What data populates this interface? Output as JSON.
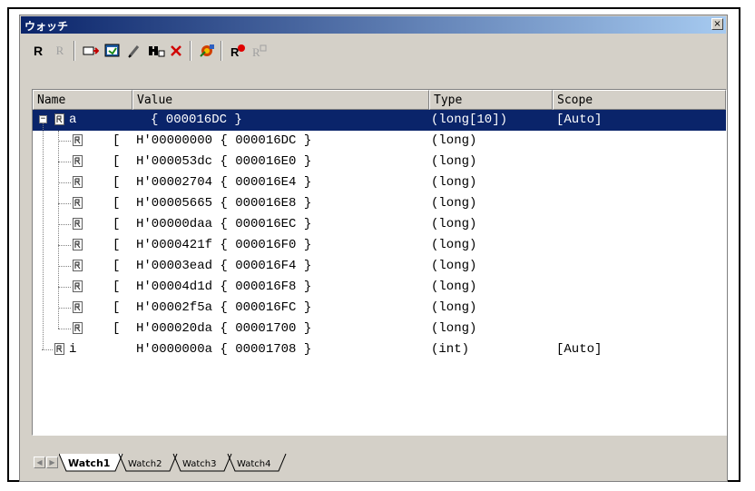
{
  "window": {
    "title": "ウォッチ",
    "close_glyph": "×"
  },
  "toolbar": {
    "icons": [
      "r-bold-icon",
      "r-disabled-icon",
      "add-watch-icon",
      "refresh-icon",
      "edit-pencil-icon",
      "find-icon",
      "delete-x-icon",
      "settings-icon",
      "record-icon",
      "record-disabled-icon"
    ],
    "r_label": "R",
    "r_disabled_label": "R"
  },
  "columns": [
    "Name",
    "Value",
    "Type",
    "Scope"
  ],
  "rows": [
    {
      "name": "a",
      "bracket": "",
      "value": "{ 000016DC }",
      "type": "(long[10])",
      "scope": "[Auto]",
      "selected": true,
      "level": 0,
      "expander": "−"
    },
    {
      "name": "",
      "bracket": "[",
      "value": "H'00000000 { 000016DC }",
      "type": "(long)",
      "scope": "",
      "level": 1
    },
    {
      "name": "",
      "bracket": "[",
      "value": "H'000053dc { 000016E0 }",
      "type": "(long)",
      "scope": "",
      "level": 1
    },
    {
      "name": "",
      "bracket": "[",
      "value": "H'00002704 { 000016E4 }",
      "type": "(long)",
      "scope": "",
      "level": 1
    },
    {
      "name": "",
      "bracket": "[",
      "value": "H'00005665 { 000016E8 }",
      "type": "(long)",
      "scope": "",
      "level": 1
    },
    {
      "name": "",
      "bracket": "[",
      "value": "H'00000daa { 000016EC }",
      "type": "(long)",
      "scope": "",
      "level": 1
    },
    {
      "name": "",
      "bracket": "[",
      "value": "H'0000421f { 000016F0 }",
      "type": "(long)",
      "scope": "",
      "level": 1
    },
    {
      "name": "",
      "bracket": "[",
      "value": "H'00003ead { 000016F4 }",
      "type": "(long)",
      "scope": "",
      "level": 1
    },
    {
      "name": "",
      "bracket": "[",
      "value": "H'00004d1d { 000016F8 }",
      "type": "(long)",
      "scope": "",
      "level": 1
    },
    {
      "name": "",
      "bracket": "[",
      "value": "H'00002f5a { 000016FC }",
      "type": "(long)",
      "scope": "",
      "level": 1
    },
    {
      "name": "",
      "bracket": "[",
      "value": "H'000020da { 00001700 }",
      "type": "(long)",
      "scope": "",
      "level": 1
    },
    {
      "name": "i",
      "bracket": "",
      "value": "H'0000000a { 00001708 }",
      "type": "(int)",
      "scope": "[Auto]",
      "level": 0
    }
  ],
  "tabs": [
    "Watch1",
    "Watch2",
    "Watch3",
    "Watch4"
  ],
  "active_tab": "Watch1",
  "colors": {
    "selection": "#0a246a",
    "titlebar_start": "#0a246a",
    "titlebar_end": "#a6caf0",
    "chrome": "#d4d0c8"
  }
}
